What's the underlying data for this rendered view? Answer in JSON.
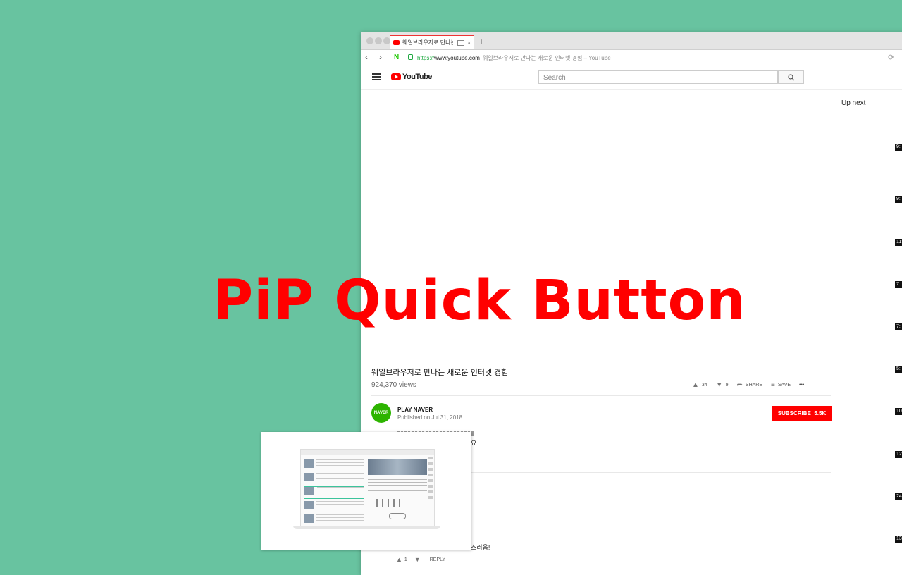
{
  "browser": {
    "tab": {
      "title": "웨일브라우저로 만나는 새로",
      "close": "×"
    },
    "newtab": "+",
    "address": {
      "scheme": "https://",
      "host": "www.youtube.com",
      "page_title": "웨일브라우저로 만나는 새로운 인터넷 경험 – YouTube"
    },
    "back": "‹",
    "forward": "›",
    "reload": "⟳",
    "naver_n": "N"
  },
  "youtube": {
    "logo_text": "YouTube",
    "search_placeholder": "Search",
    "up_next": "Up next",
    "durations": [
      "9:",
      "9:",
      "11:",
      "7:",
      "7:",
      "5:",
      "10:",
      "12:",
      "24:",
      "13:"
    ],
    "video": {
      "title": "웨일브라우저로 만나는 새로운 인터넷 경험",
      "views": "924,370 views",
      "likes": "34",
      "dislikes": "9",
      "share": "SHARE",
      "save": "SAVE",
      "more": "•••",
      "like_ratio": 0.79
    },
    "channel": {
      "name": "PLAY NAVER",
      "avatar_text": "NAVER",
      "published": "Published on Jul 31, 2018",
      "subscribe_label": "SUBSCRIBE",
      "subscribers": "5.5K"
    },
    "description_end": "요",
    "comment_end": "스러움!",
    "comment_actions": {
      "likes": "1",
      "reply": "REPLY"
    }
  },
  "overlay_title": "PiP Quick Button",
  "colors": {
    "background": "#68c3a0",
    "accent": "#ff0000",
    "naver_green": "#2db400"
  }
}
